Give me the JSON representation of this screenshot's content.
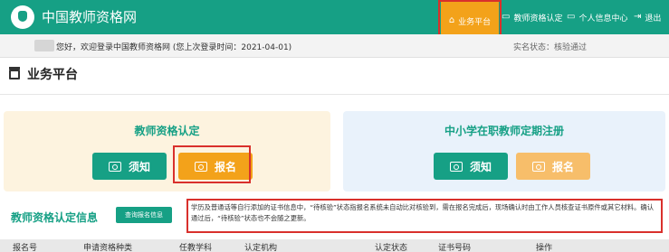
{
  "header": {
    "site_title": "中国教师资格网",
    "nav": [
      {
        "label": "业务平台",
        "icon": "home-icon"
      },
      {
        "label": "教师资格认定",
        "icon": "monitor-icon"
      },
      {
        "label": "个人信息中心",
        "icon": "monitor-icon"
      },
      {
        "label": "退出",
        "icon": "logout-icon"
      }
    ]
  },
  "welcome": {
    "greeting": "您好，欢迎登录中国教师资格网 (您上次登录时间：2021-04-01)",
    "verify_status": "实名状态：核验通过"
  },
  "page": {
    "title": "业务平台"
  },
  "cards": {
    "left": {
      "title": "教师资格认定",
      "btn_notice": "须知",
      "btn_apply": "报名"
    },
    "right": {
      "title": "中小学在职教师定期注册",
      "btn_notice": "须知",
      "btn_apply": "报名"
    }
  },
  "info": {
    "title": "教师资格认定信息",
    "query_button": "查询报名信息",
    "notice_text": "学历及普通话等自行添加的证书信息中，“待核验”状态指报名系统未自动比对核验到，需在报名完成后，现场确认时由工作人员核查证书原件或其它材料。确认通过后，“待核验”状态也不会随之更新。"
  },
  "table": {
    "columns": [
      "报名号",
      "申请资格种类",
      "任教学科",
      "认定机构",
      "认定状态",
      "证书号码",
      "操作"
    ]
  },
  "colors": {
    "brand_green": "#16a085",
    "accent_orange": "#f3a21a",
    "highlight_red": "#d9302c"
  }
}
